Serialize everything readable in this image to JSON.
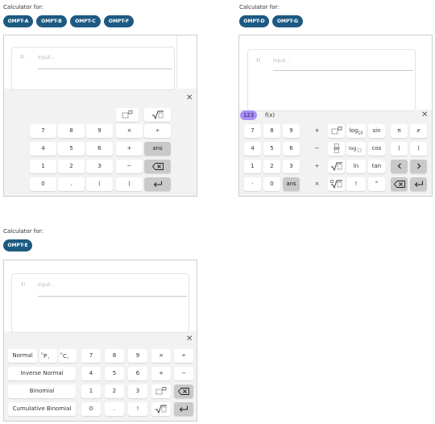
{
  "calc1": {
    "caption": "Calculator for:",
    "tags": [
      "OMPT-A",
      "OMPT-B",
      "OMPT-C",
      "OMPT-F"
    ],
    "line_number": "1)",
    "input_placeholder": "Input...",
    "keys": {
      "r1": [
        "7",
        "8",
        "9",
        "×",
        "÷"
      ],
      "r2": [
        "4",
        "5",
        "6",
        "+",
        "ans"
      ],
      "r3": [
        "1",
        "2",
        "3",
        "−"
      ],
      "r4": [
        "0",
        ".",
        "(",
        ")"
      ]
    }
  },
  "calc2": {
    "caption": "Calculator for:",
    "tags": [
      "OMPT-D",
      "OMPT-G"
    ],
    "line_number": "1)",
    "input_placeholder": "Input...",
    "tab_123": "123",
    "tab_fx": "f(x)",
    "keys": {
      "r1": [
        "7",
        "8",
        "9",
        "+",
        "log10",
        "sin",
        "π",
        "e"
      ],
      "r2": [
        "4",
        "5",
        "6",
        "−",
        "cos",
        "(",
        ")"
      ],
      "r3": [
        "1",
        "2",
        "3",
        "÷",
        "ln",
        "tan"
      ],
      "r4": [
        "·",
        "0",
        "ans",
        "×",
        "!",
        "°"
      ]
    }
  },
  "calc3": {
    "caption": "Calculator for:",
    "tags": [
      "OMPT-E"
    ],
    "line_number": "1)",
    "input_placeholder": "Input...",
    "side_keys": {
      "normal": "Normal",
      "inverse_normal": "Inverse Normal",
      "binomial": "Binomial",
      "cumulative_binomial": "Cumulative Binomial"
    },
    "keys": {
      "r1": [
        "7",
        "8",
        "9",
        "×",
        "÷"
      ],
      "r2": [
        "4",
        "5",
        "6",
        "+",
        "−"
      ],
      "r3": [
        "1",
        "2",
        "3"
      ],
      "r4": [
        "0",
        ".",
        "!"
      ]
    }
  },
  "colors": {
    "tag_bg": "#1d5a82",
    "tab_active_bg": "#a98ff5",
    "panel_bg": "#f2f2f2",
    "dark_key_bg": "#c9c9c9"
  }
}
